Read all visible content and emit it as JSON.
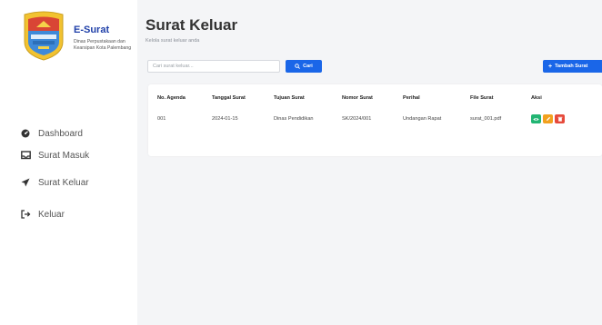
{
  "sidebar": {
    "brand": {
      "title": "E-Surat",
      "subtitle": "Dinas Perpustakaan dan Kearsipan Kota Palembang"
    },
    "items": [
      {
        "label": "Dashboard",
        "icon": "gauge-icon"
      },
      {
        "label": "Surat Masuk",
        "icon": "inbox-icon"
      },
      {
        "label": "Surat Keluar",
        "icon": "send-icon"
      },
      {
        "label": "Keluar",
        "icon": "logout-icon"
      }
    ]
  },
  "main": {
    "title": "Surat Keluar",
    "subtitle": "Kelola surat keluar anda",
    "search": {
      "placeholder": "Cari surat keluar...",
      "button_label": "Cari"
    },
    "add_button_label": "Tambah Surat",
    "table": {
      "headers": [
        "No. Agenda",
        "Tanggal Surat",
        "Tujuan Surat",
        "Nomor Surat",
        "Perihal",
        "File Surat",
        "Aksi"
      ],
      "rows": [
        [
          "001",
          "2024-01-15",
          "Dinas Pendidikan",
          "SK/2024/001",
          "Undangan Rapat",
          "surat_001.pdf"
        ]
      ]
    }
  },
  "colors": {
    "primary": "#1a66e8",
    "brand_title": "#1f3fa8",
    "action_view": "#22b573",
    "action_edit": "#f2a11f",
    "action_delete": "#e64a3b"
  }
}
